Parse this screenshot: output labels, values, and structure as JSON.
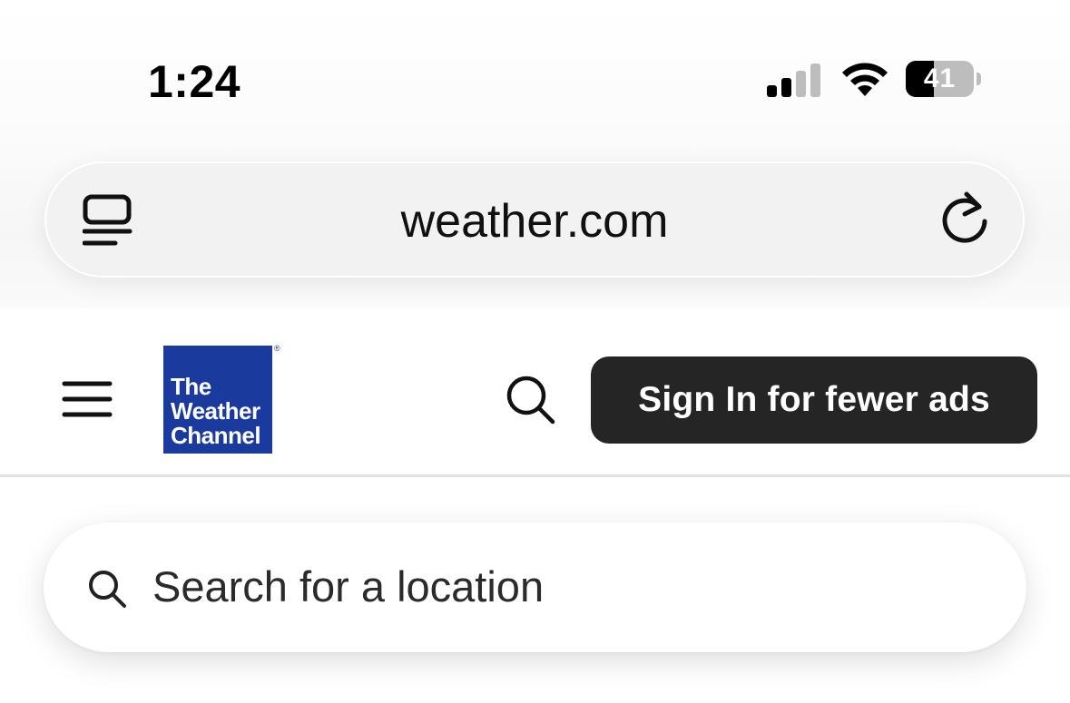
{
  "status_bar": {
    "time": "1:24",
    "battery_level": "41",
    "battery_fraction": 0.41,
    "icons": [
      "signal-icon",
      "wifi-icon",
      "battery-icon"
    ]
  },
  "browser": {
    "url": "weather.com",
    "reader_icon": "reader-mode-icon",
    "reload_icon": "reload-icon"
  },
  "site_header": {
    "menu_icon": "hamburger-menu-icon",
    "logo_lines": [
      "The",
      "Weather",
      "Channel"
    ],
    "logo_color": "#1b3a9e",
    "search_icon": "search-icon",
    "signin_label": "Sign In for fewer ads",
    "signin_color": "#252525"
  },
  "location_search": {
    "placeholder": "Search for a location",
    "value": ""
  }
}
